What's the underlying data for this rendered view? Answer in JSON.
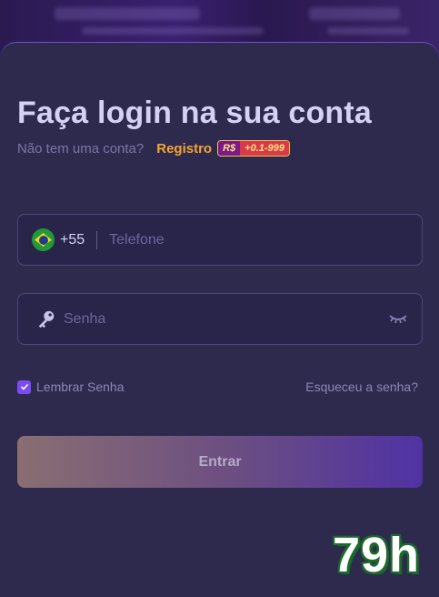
{
  "login": {
    "title": "Faça login na sua conta",
    "no_account_text": "Não tem uma conta?",
    "register_link": "Registro",
    "bonus_badge": {
      "currency": "R$",
      "value": "+0.1-999"
    }
  },
  "phone_field": {
    "country_code": "+55",
    "placeholder": "Telefone",
    "flag": "brazil-flag-icon"
  },
  "password_field": {
    "placeholder": "Senha",
    "icon": "key-icon",
    "toggle_icon": "eye-closed-icon"
  },
  "remember": {
    "label": "Lembrar Senha",
    "checked": true
  },
  "forgot_link": "Esqueceu a senha?",
  "submit_label": "Entrar",
  "watermark": "79h",
  "colors": {
    "panel": "#2e2a4e",
    "accent": "#7a4bf0",
    "register": "#f2a531",
    "field_border": "#4d4878"
  }
}
